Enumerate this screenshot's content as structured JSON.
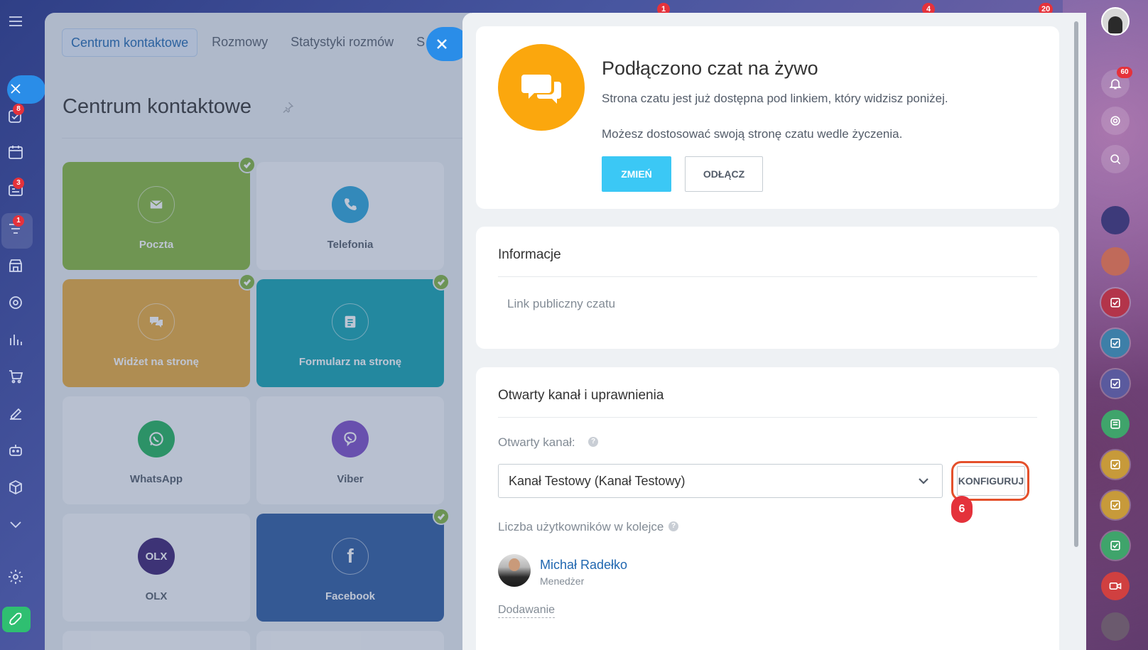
{
  "colors": {
    "accent": "#3bc8f5",
    "link": "#2067b0",
    "highlight": "#e4502b",
    "live_chat_logo": "#fba70d"
  },
  "top_badges": [
    "1",
    "4",
    "20"
  ],
  "left_nav": {
    "badges": {
      "tasks": "8",
      "feed": "3",
      "crm": "1"
    }
  },
  "background_panel": {
    "tabs": [
      {
        "label": "Centrum kontaktowe",
        "active": true
      },
      {
        "label": "Rozmowy",
        "active": false
      },
      {
        "label": "Statystyki rozmów",
        "active": false
      },
      {
        "label": "S",
        "active": false
      }
    ],
    "page_title": "Centrum kontaktowe",
    "tiles": [
      {
        "label": "Poczta",
        "icon": "mail-icon",
        "connected": true
      },
      {
        "label": "Telefonia",
        "icon": "phone-icon",
        "connected": false
      },
      {
        "label": "Widżet na stronę",
        "icon": "chat-icon",
        "connected": true
      },
      {
        "label": "Formularz na stronę",
        "icon": "form-icon",
        "connected": true
      },
      {
        "label": "WhatsApp",
        "icon": "whatsapp-icon",
        "connected": false
      },
      {
        "label": "Viber",
        "icon": "viber-icon",
        "connected": false
      },
      {
        "label": "OLX",
        "icon": "olx-icon",
        "connected": false
      },
      {
        "label": "Facebook",
        "icon": "facebook-icon",
        "connected": true
      }
    ]
  },
  "live_chat": {
    "title": "Podłączono czat na żywo",
    "text1": "Strona czatu jest już dostępna pod linkiem, który widzisz poniżej.",
    "text2": "Możesz dostosować swoją stronę czatu wedle życzenia.",
    "change_button": "ZMIEŃ",
    "detach_button": "ODŁĄCZ"
  },
  "info": {
    "heading": "Informacje",
    "public_link_label": "Link publiczny czatu"
  },
  "open_channel": {
    "heading": "Otwarty kanał i uprawnienia",
    "channel_label": "Otwarty kanał:",
    "channel_value": "Kanał Testowy (Kanał Testowy)",
    "configure_button": "KONFIGURUJ",
    "step_number": "6",
    "queue_label": "Liczba użytkowników w kolejce",
    "user_name": "Michał Radełko",
    "user_role": "Menedżer",
    "add_link": "Dodawanie"
  },
  "right_bar": {
    "notifications_badge": "60"
  }
}
